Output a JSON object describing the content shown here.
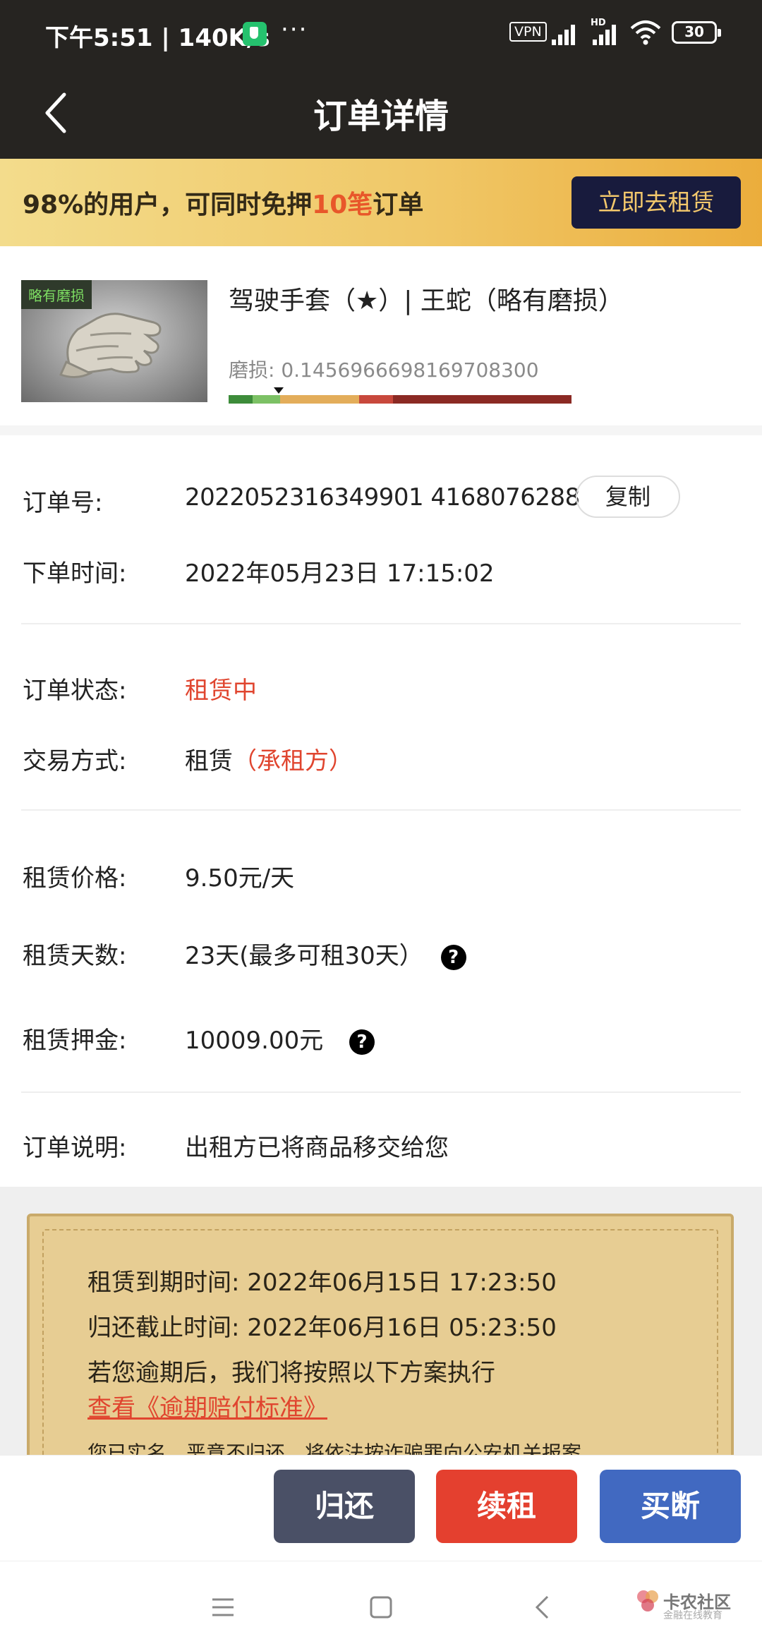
{
  "status_bar": {
    "time": "下午5:51 | 140K/s",
    "more": "···",
    "vpn": "VPN",
    "hd": "HD",
    "battery": "30"
  },
  "header": {
    "title": "订单详情"
  },
  "promo": {
    "text_before": "98%的用户，可同时免押",
    "highlight": "10笔",
    "text_after": "订单",
    "button": "立即去租赁",
    "highlight_color": "#e8572a"
  },
  "product": {
    "tag": "略有磨损",
    "name": "驾驶手套（★）| 王蛇（略有磨损）",
    "wear_label": "磨损:",
    "wear_value": "0.1456966698169708300",
    "wear_scale": [
      {
        "color": "#3d8c3a",
        "portion": 0.07
      },
      {
        "color": "#7cc165",
        "portion": 0.08
      },
      {
        "color": "#e3ad5a",
        "portion": 0.23
      },
      {
        "color": "#c8483c",
        "portion": 0.1
      },
      {
        "color": "#8b2a24",
        "portion": 0.52
      }
    ]
  },
  "details": {
    "order_no_label": "订单号:",
    "order_no": "2022052316349901 4168076288",
    "copy_button": "复制",
    "order_time_label": "下单时间:",
    "order_time": "2022年05月23日 17:15:02",
    "status_label": "订单状态:",
    "status": "租赁中",
    "trade_label": "交易方式:",
    "trade_value": "租赁",
    "trade_sub": "（承租方）",
    "price_label": "租赁价格:",
    "price": "9.50元/天",
    "days_label": "租赁天数:",
    "days": "23天(最多可租30天）",
    "deposit_label": "租赁押金:",
    "deposit": "10009.00元",
    "help": "?",
    "note_label": "订单说明:",
    "note": "出租方已将商品移交给您"
  },
  "notice": {
    "expire": "租赁到期时间: 2022年06月15日 17:23:50",
    "return_deadline": "归还截止时间: 2022年06月16日 05:23:50",
    "overdue": "若您逾期后，我们将按照以下方案执行",
    "link": "查看《逾期赔付标准》",
    "warning": "您已实名，恶意不归还，将依法按诈骗罪向公安机关报案"
  },
  "actions": [
    {
      "label": "归还",
      "color": "#4a5066"
    },
    {
      "label": "续租",
      "color": "#e4402f"
    },
    {
      "label": "买断",
      "color": "#4169c1"
    }
  ],
  "watermark": {
    "title": "卡农社区",
    "sub": "金融在线教育"
  }
}
